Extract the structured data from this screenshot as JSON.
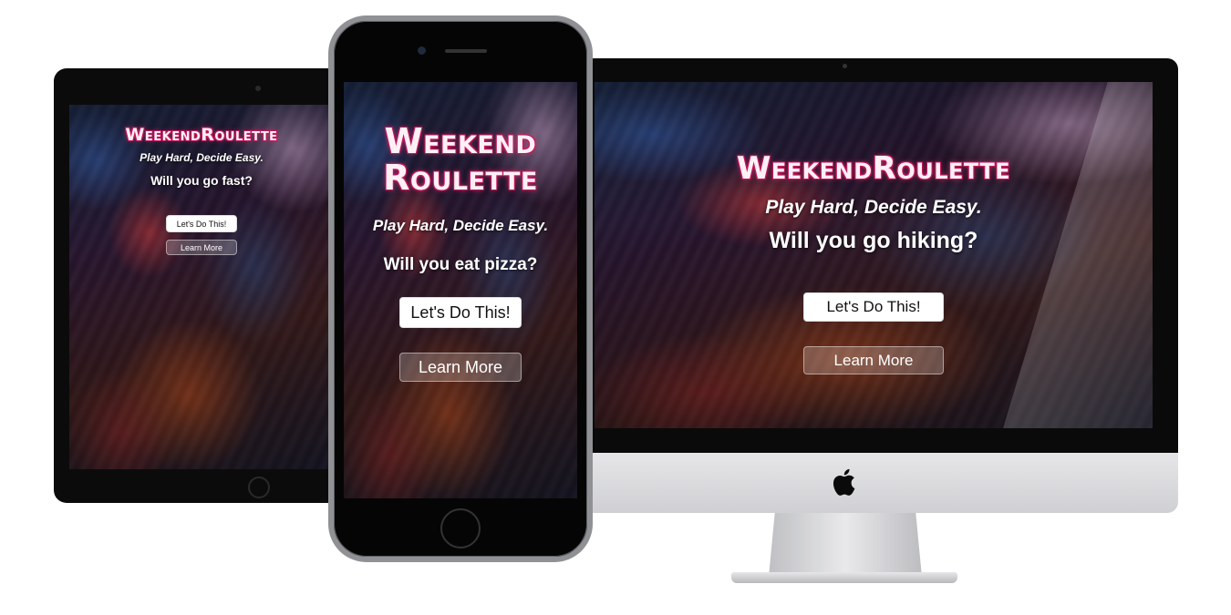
{
  "brand": {
    "single_line": "WeekendRoulette",
    "line1": "Weekend",
    "line2": "Roulette"
  },
  "tagline": "Play Hard, Decide Easy.",
  "tablet": {
    "question": "Will you go fast?",
    "primary_button": "Let's Do This!",
    "secondary_button": "Learn More"
  },
  "phone": {
    "question": "Will you eat pizza?",
    "primary_button": "Let's Do This!",
    "secondary_button": "Learn More"
  },
  "desktop": {
    "question": "Will you go hiking?",
    "primary_button": "Let's Do This!",
    "secondary_button": "Learn More"
  },
  "colors": {
    "brand_outline": "#c2185b",
    "brand_fill": "#fff0f6",
    "device_frame": "#0b0b0b",
    "imac_chin": "#cfd0d3"
  },
  "icons": {
    "imac_logo": "apple-logo-icon"
  }
}
